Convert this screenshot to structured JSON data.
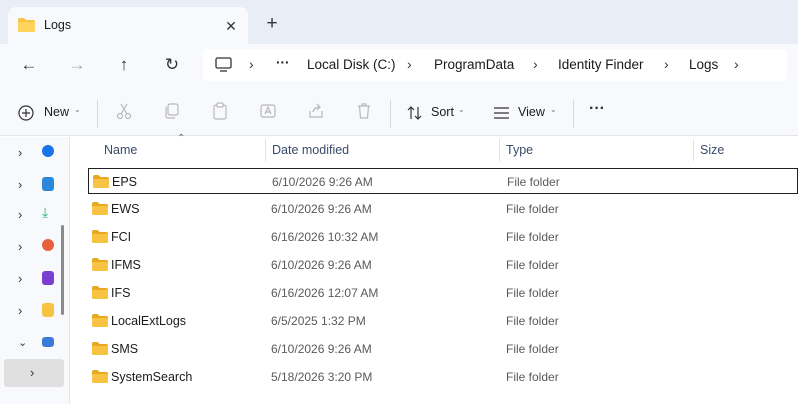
{
  "window": {
    "tab_title": "Logs",
    "close_glyph": "✕",
    "newtab_glyph": "+"
  },
  "nav": {
    "back_glyph": "←",
    "forward_glyph": "→",
    "up_glyph": "↑",
    "refresh_glyph": "↻"
  },
  "address": {
    "overflow": "···",
    "crumbs": [
      "Local Disk (C:)",
      "ProgramData",
      "Identity Finder",
      "Logs"
    ],
    "sep": "›"
  },
  "toolbar": {
    "new_label": "New",
    "sort_label": "Sort",
    "view_label": "View",
    "more_glyph": "···"
  },
  "columns": {
    "name": "Name",
    "date": "Date modified",
    "type": "Type",
    "size": "Size"
  },
  "files": [
    {
      "name": "EPS",
      "date": "6/10/2026 9:26 AM",
      "type": "File folder"
    },
    {
      "name": "EWS",
      "date": "6/10/2026 9:26 AM",
      "type": "File folder"
    },
    {
      "name": "FCI",
      "date": "6/16/2026 10:32 AM",
      "type": "File folder"
    },
    {
      "name": "IFMS",
      "date": "6/10/2026 9:26 AM",
      "type": "File folder"
    },
    {
      "name": "IFS",
      "date": "6/16/2026 12:07 AM",
      "type": "File folder"
    },
    {
      "name": "LocalExtLogs",
      "date": "6/5/2025 1:32 PM",
      "type": "File folder"
    },
    {
      "name": "SMS",
      "date": "6/10/2026 9:26 AM",
      "type": "File folder"
    },
    {
      "name": "SystemSearch",
      "date": "5/18/2026 3:20 PM",
      "type": "File folder"
    }
  ],
  "colors": {
    "folder": "#f6c343",
    "accent": "#0067c0"
  }
}
